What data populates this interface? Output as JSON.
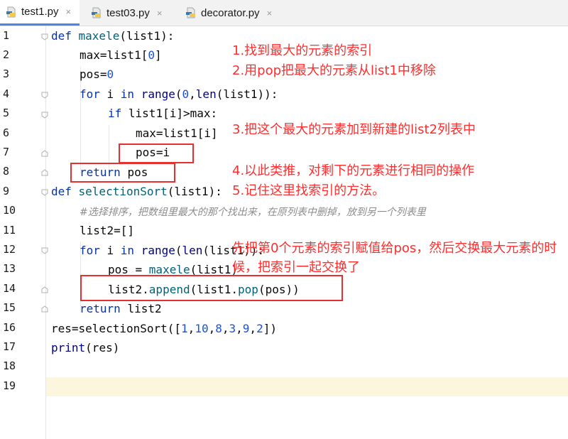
{
  "tabs": [
    {
      "label": "test1.py",
      "active": true
    },
    {
      "label": "test03.py",
      "active": false
    },
    {
      "label": "decorator.py",
      "active": false
    }
  ],
  "tab_close_glyph": "×",
  "line_numbers": [
    "1",
    "2",
    "3",
    "4",
    "5",
    "6",
    "7",
    "8",
    "9",
    "10",
    "11",
    "12",
    "13",
    "14",
    "15",
    "16",
    "17",
    "18",
    "19"
  ],
  "code": {
    "l1": {
      "kw": "def ",
      "fn": "maxele",
      "rest": "(list1):"
    },
    "l2": {
      "a": "max=list1[",
      "num": "0",
      "b": "]"
    },
    "l3": {
      "a": "pos=",
      "num": "0"
    },
    "l4": {
      "kw1": "for ",
      "a": "i ",
      "kw2": "in ",
      "bi": "range",
      "b": "(",
      "num": "0",
      "c": ",",
      "bi2": "len",
      "d": "(list1)):"
    },
    "l5": {
      "kw": "if ",
      "a": "list1[i]>max:"
    },
    "l6": {
      "a": "max=list1[i]"
    },
    "l7": {
      "a": "pos=i"
    },
    "l8": {
      "kw": "return ",
      "a": "pos"
    },
    "l9": {
      "kw": "def ",
      "fn": "selectionSort",
      "rest": "(list1):"
    },
    "l10": {
      "comment": "#选择排序，把数组里最大的那个找出来，在原列表中删掉，放到另一个列表里"
    },
    "l11": {
      "a": "list2=[]"
    },
    "l12": {
      "kw1": "for ",
      "a": "i ",
      "kw2": "in ",
      "bi": "range",
      "b": "(",
      "bi2": "len",
      "c": "(list1)):"
    },
    "l13": {
      "a": "pos = ",
      "fn": "maxele",
      "b": "(list1)"
    },
    "l14": {
      "a": "list2.",
      "fn": "append",
      "b": "(list1.",
      "fn2": "pop",
      "c": "(pos))"
    },
    "l15": {
      "kw": "return ",
      "a": "list2"
    },
    "l16": {
      "a": "res=selectionSort([",
      "n1": "1",
      "c1": ",",
      "n2": "10",
      "c2": ",",
      "n3": "8",
      "c3": ",",
      "n4": "3",
      "c4": ",",
      "n5": "9",
      "c5": ",",
      "n6": "2",
      "b": "])"
    },
    "l17": {
      "bi": "print",
      "a": "(res)"
    }
  },
  "annotations": {
    "n1": "1.找到最大的元素的索引",
    "n2": "2.用pop把最大的元素从list1中移除",
    "n3": "3.把这个最大的元素加到新建的list2列表中",
    "n4": "4.以此类推，对剩下的元素进行相同的操作",
    "n5": "5.记住这里找索引的方法。",
    "n6": "先把第0个元素的索引赋值给pos，然后交换最大元素的时候，把索引一起交换了"
  },
  "colors": {
    "annotation": "#ff2d2d",
    "keyword": "#0033b3",
    "function": "#00627a",
    "number": "#1750eb",
    "current_line": "#fcf6dc",
    "active_tab_underline": "#4a86e8"
  },
  "icons": {
    "file_tab": "python-file-icon",
    "fold": "fold-marker-icon"
  }
}
